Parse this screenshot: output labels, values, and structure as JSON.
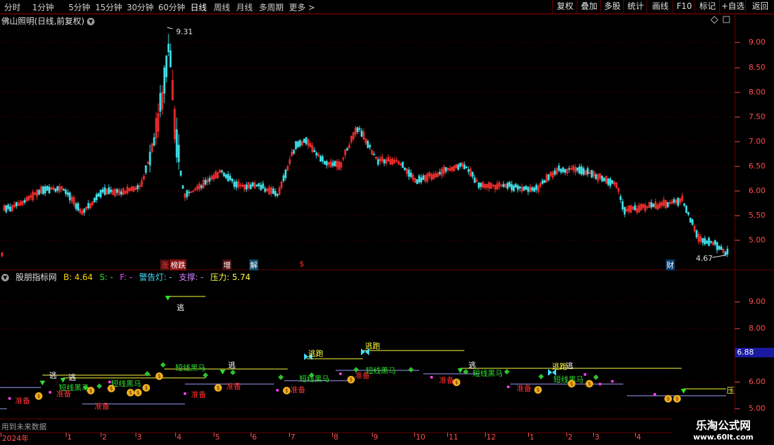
{
  "toolbar": {
    "periods": [
      "分时",
      "1分钟",
      "5分钟",
      "15分钟",
      "30分钟",
      "60分钟",
      "日线",
      "周线",
      "月线",
      "多周期",
      "更多"
    ],
    "active_period": "日线",
    "buttons": [
      "复权",
      "叠加",
      "多股",
      "统计",
      "画线",
      "F10",
      "标记",
      "+自选",
      "返回"
    ]
  },
  "chart": {
    "title": "佛山照明(日线,前复权)",
    "high_label": "9.31",
    "low_label": "4.67",
    "price_ticks": [
      "9.00",
      "8.50",
      "8.00",
      "7.50",
      "7.00",
      "6.50",
      "6.00",
      "5.50",
      "5.00"
    ],
    "events": [
      {
        "text": "涨",
        "color": "#ff3030",
        "bg": "#501010"
      },
      {
        "text": "榜跌",
        "color": "#ffffff",
        "bg": "#8a1010"
      },
      {
        "text": "增",
        "color": "#ffffff",
        "bg": "#501010"
      },
      {
        "text": "解",
        "color": "#ffffff",
        "bg": "#0b4a6a"
      },
      {
        "text": "$",
        "color": "#ff3030",
        "bg": "#000000"
      },
      {
        "text": "财",
        "color": "#ffffff",
        "bg": "#0b3a6a"
      }
    ]
  },
  "indicator": {
    "name": "股朋指标网",
    "values": [
      {
        "text": "B: 4.64",
        "color": "#ffd700"
      },
      {
        "text": "S: -",
        "color": "#30e030"
      },
      {
        "text": "F: -",
        "color": "#ff40ff"
      },
      {
        "text": "警告灯: -",
        "color": "#40e0ff"
      },
      {
        "text": "支撑: -",
        "color": "#d080ff"
      },
      {
        "text": "压力: 5.74",
        "color": "#ffff40"
      }
    ],
    "ticks": [
      "9.00",
      "8.00",
      "6.00",
      "5.00"
    ],
    "current_value": "6.88",
    "signal_labels": {
      "escape": "逃",
      "run": "逃跑",
      "prepare": "准备",
      "dark_horse": "短线黑马",
      "pressure": "压"
    }
  },
  "footer": {
    "note": "用到未来数据",
    "months": [
      "2024年",
      "1",
      "2",
      "3",
      "4",
      "5",
      "6",
      "7",
      "8",
      "9",
      "10",
      "11",
      "12",
      "1",
      "2",
      "3",
      "4"
    ]
  },
  "watermark": {
    "title": "乐淘公式网",
    "url": "www.60lt.com"
  },
  "colors": {
    "up": "#ff3030",
    "down": "#40e0e8",
    "grid": "#6a0000",
    "axis_text": "#ff5050"
  }
}
